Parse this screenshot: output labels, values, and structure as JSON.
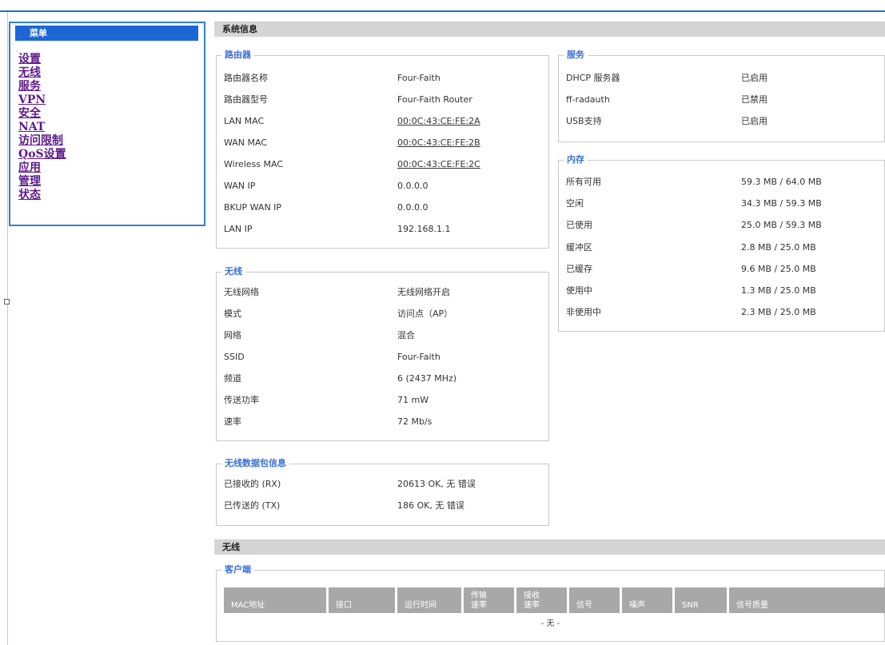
{
  "menu": {
    "title": "菜单",
    "items": [
      "设置",
      "无线",
      "服务",
      "VPN",
      "安全",
      "NAT",
      "访问限制",
      "QoS设置",
      "应用",
      "管理",
      "状态"
    ]
  },
  "system_info": {
    "title": "系统信息",
    "router": {
      "legend": "路由器",
      "rows": [
        {
          "label": "路由器名称",
          "value": "Four-Faith"
        },
        {
          "label": "路由器型号",
          "value": "Four-Faith Router"
        },
        {
          "label": "LAN MAC",
          "value": "00:0C:43:CE:FE:2A"
        },
        {
          "label": "WAN MAC",
          "value": "00:0C:43:CE:FE:2B"
        },
        {
          "label": "Wireless MAC",
          "value": "00:0C:43:CE:FE:2C"
        },
        {
          "label": "WAN IP",
          "value": "0.0.0.0"
        },
        {
          "label": "BKUP WAN IP",
          "value": "0.0.0.0"
        },
        {
          "label": "LAN IP",
          "value": "192.168.1.1"
        }
      ]
    },
    "wireless": {
      "legend": "无线",
      "rows": [
        {
          "label": "无线网络",
          "value": "无线网络开启"
        },
        {
          "label": "模式",
          "value": "访问点（AP）"
        },
        {
          "label": "网络",
          "value": "混合"
        },
        {
          "label": "SSID",
          "value": "Four-Faith"
        },
        {
          "label": "频道",
          "value": "6 (2437 MHz)"
        },
        {
          "label": "传送功率",
          "value": "71 mW"
        },
        {
          "label": "速率",
          "value": "72 Mb/s"
        }
      ]
    },
    "packets": {
      "legend": "无线数据包信息",
      "rows": [
        {
          "label": "已接收的 (RX)",
          "value": "20613 OK, 无 错误"
        },
        {
          "label": "已传送的 (TX)",
          "value": "186 OK, 无 错误"
        }
      ]
    },
    "services": {
      "legend": "服务",
      "rows": [
        {
          "label": "DHCP 服务器",
          "value": "已启用"
        },
        {
          "label": "ff-radauth",
          "value": "已禁用"
        },
        {
          "label": "USB支持",
          "value": "已启用"
        }
      ]
    },
    "memory": {
      "legend": "内存",
      "rows": [
        {
          "label": "所有可用",
          "value": "59.3 MB / 64.0 MB"
        },
        {
          "label": "空闲",
          "value": "34.3 MB / 59.3 MB"
        },
        {
          "label": "已使用",
          "value": "25.0 MB / 59.3 MB"
        },
        {
          "label": "缓冲区",
          "value": "2.8 MB / 25.0 MB"
        },
        {
          "label": "已缓存",
          "value": "9.6 MB / 25.0 MB"
        },
        {
          "label": "使用中",
          "value": "1.3 MB / 25.0 MB"
        },
        {
          "label": "非使用中",
          "value": "2.3 MB / 25.0 MB"
        }
      ]
    }
  },
  "wireless_section": {
    "title": "无线",
    "clients": {
      "legend": "客户端",
      "columns": [
        "MAC地址",
        "接口",
        "运行时间",
        "传输 速率",
        "接收 速率",
        "信号",
        "噪声",
        "SNR",
        "信号质量"
      ],
      "empty_text": "- 无 -"
    }
  },
  "colors": {
    "accent": "#1a74c9",
    "menu_header": "#1c66d6",
    "legend": "#3a6fd6",
    "link_visited": "#5e1a8b",
    "table_header": "#a8a8a8",
    "section_bar": "#d5d5d5"
  }
}
